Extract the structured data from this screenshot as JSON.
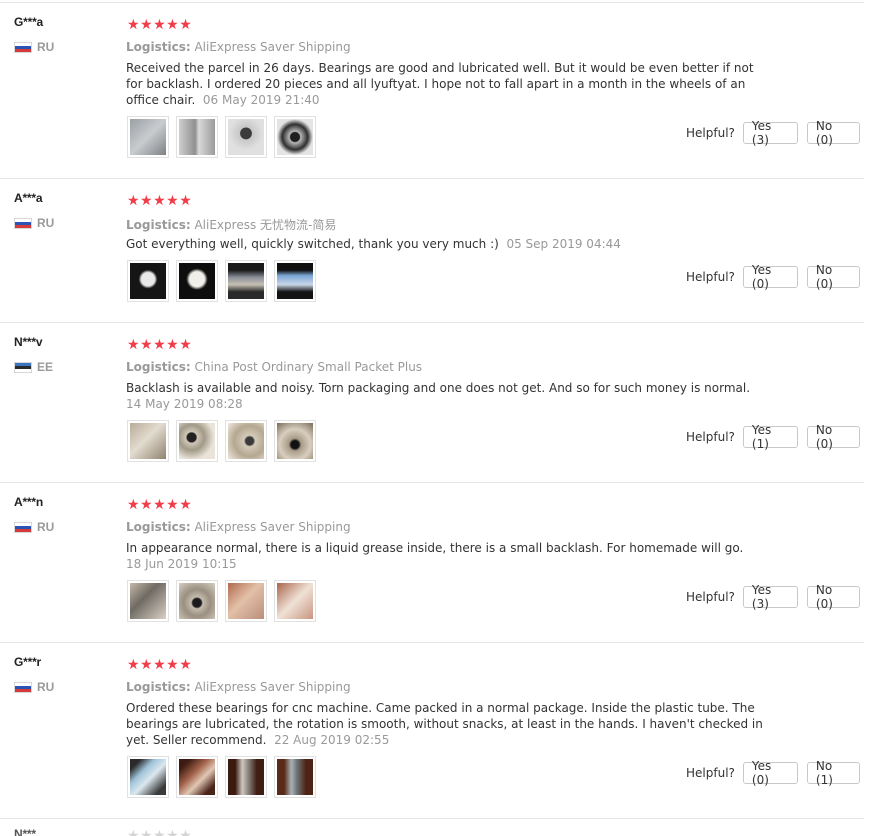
{
  "reviews": [
    {
      "user": "G***a",
      "country": "RU",
      "stars": "★★★★★",
      "logistics_label": "Logistics:",
      "logistics_value": "AliExpress Saver Shipping",
      "text": "Received the parcel in 26 days. Bearings are good and lubricated well. But it would be even better if not for backlash. I ordered 20 pieces and all lyuftyat. I hope not to fall apart in a month in the wheels of an office chair.",
      "date": "06 May 2019 21:40",
      "helpful_label": "Helpful?",
      "yes_label": "Yes (3)",
      "no_label": "No (0)"
    },
    {
      "user": "A***a",
      "country": "RU",
      "stars": "★★★★★",
      "logistics_label": "Logistics:",
      "logistics_value": "AliExpress 无忧物流-简易",
      "text": "Got everything well, quickly switched, thank you very much :)",
      "date": "05 Sep 2019 04:44",
      "helpful_label": "Helpful?",
      "yes_label": "Yes (0)",
      "no_label": "No (0)"
    },
    {
      "user": "N***v",
      "country": "EE",
      "stars": "★★★★★",
      "logistics_label": "Logistics:",
      "logistics_value": "China Post Ordinary Small Packet Plus",
      "text": "Backlash is available and noisy. Torn packaging and one does not get. And so for such money is normal.",
      "date": "14 May 2019 08:28",
      "helpful_label": "Helpful?",
      "yes_label": "Yes (1)",
      "no_label": "No (0)"
    },
    {
      "user": "A***n",
      "country": "RU",
      "stars": "★★★★★",
      "logistics_label": "Logistics:",
      "logistics_value": "AliExpress Saver Shipping",
      "text": "In appearance normal, there is a liquid grease inside, there is a small backlash. For homemade will go.",
      "date": "18 Jun 2019 10:15",
      "helpful_label": "Helpful?",
      "yes_label": "Yes (3)",
      "no_label": "No (0)"
    },
    {
      "user": "G***r",
      "country": "RU",
      "stars": "★★★★★",
      "logistics_label": "Logistics:",
      "logistics_value": "AliExpress Saver Shipping",
      "text": "Ordered these bearings for cnc machine. Came packed in a normal package. Inside the plastic tube. The bearings are lubricated, the rotation is smooth, without snacks, at least in the hands. I haven't checked in yet. Seller recommend.",
      "date": "22 Aug 2019 02:55",
      "helpful_label": "Helpful?",
      "yes_label": "Yes (0)",
      "no_label": "No (1)"
    }
  ],
  "partial_review": {
    "user": "N***",
    "stars": "★★★★★"
  }
}
